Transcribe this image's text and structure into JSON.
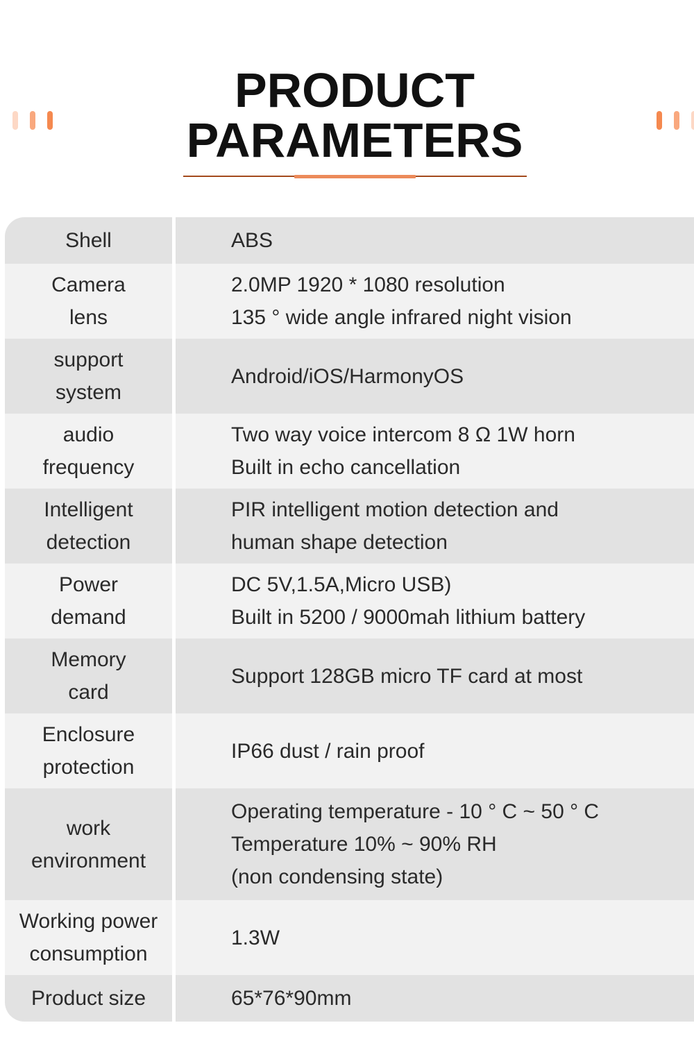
{
  "header": {
    "title_line1": "PRODUCT",
    "title_line2": "PARAMETERS",
    "accent_color": "#ec8a5a",
    "underline_color": "#a34a1d"
  },
  "decorations": {
    "left_bars": [
      "#fdd8c5",
      "#f9a87e",
      "#f5894f"
    ],
    "right_bars": [
      "#f5894f",
      "#f9a87e",
      "#fdd8c5"
    ]
  },
  "parameters": [
    {
      "label": [
        "Shell"
      ],
      "value": [
        "ABS"
      ]
    },
    {
      "label": [
        "Camera",
        "lens"
      ],
      "value": [
        "2.0MP 1920 * 1080 resolution",
        "135 ° wide angle infrared night vision"
      ]
    },
    {
      "label": [
        "support",
        "system"
      ],
      "value": [
        "Android/iOS/HarmonyOS"
      ]
    },
    {
      "label": [
        "audio",
        "frequency"
      ],
      "value": [
        "Two way voice intercom 8 Ω 1W horn",
        "Built in echo cancellation"
      ]
    },
    {
      "label": [
        "Intelligent",
        "detection"
      ],
      "value": [
        "PIR intelligent motion detection and",
        "human shape detection"
      ]
    },
    {
      "label": [
        "Power",
        "demand"
      ],
      "value": [
        "DC 5V,1.5A,Micro USB)",
        "Built in 5200 / 9000mah lithium battery"
      ]
    },
    {
      "label": [
        "Memory",
        "card"
      ],
      "value": [
        "Support 128GB micro TF card at most"
      ]
    },
    {
      "label": [
        "Enclosure",
        "protection"
      ],
      "value": [
        "IP66 dust / rain proof"
      ]
    },
    {
      "label": [
        "work",
        "environment"
      ],
      "value": [
        "Operating temperature - 10 ° C ~ 50 ° C",
        "Temperature 10% ~ 90% RH",
        "(non condensing state)"
      ]
    },
    {
      "label": [
        "Working power",
        "consumption"
      ],
      "value": [
        "1.3W"
      ]
    },
    {
      "label": [
        "Product size"
      ],
      "value": [
        "65*76*90mm"
      ]
    }
  ]
}
